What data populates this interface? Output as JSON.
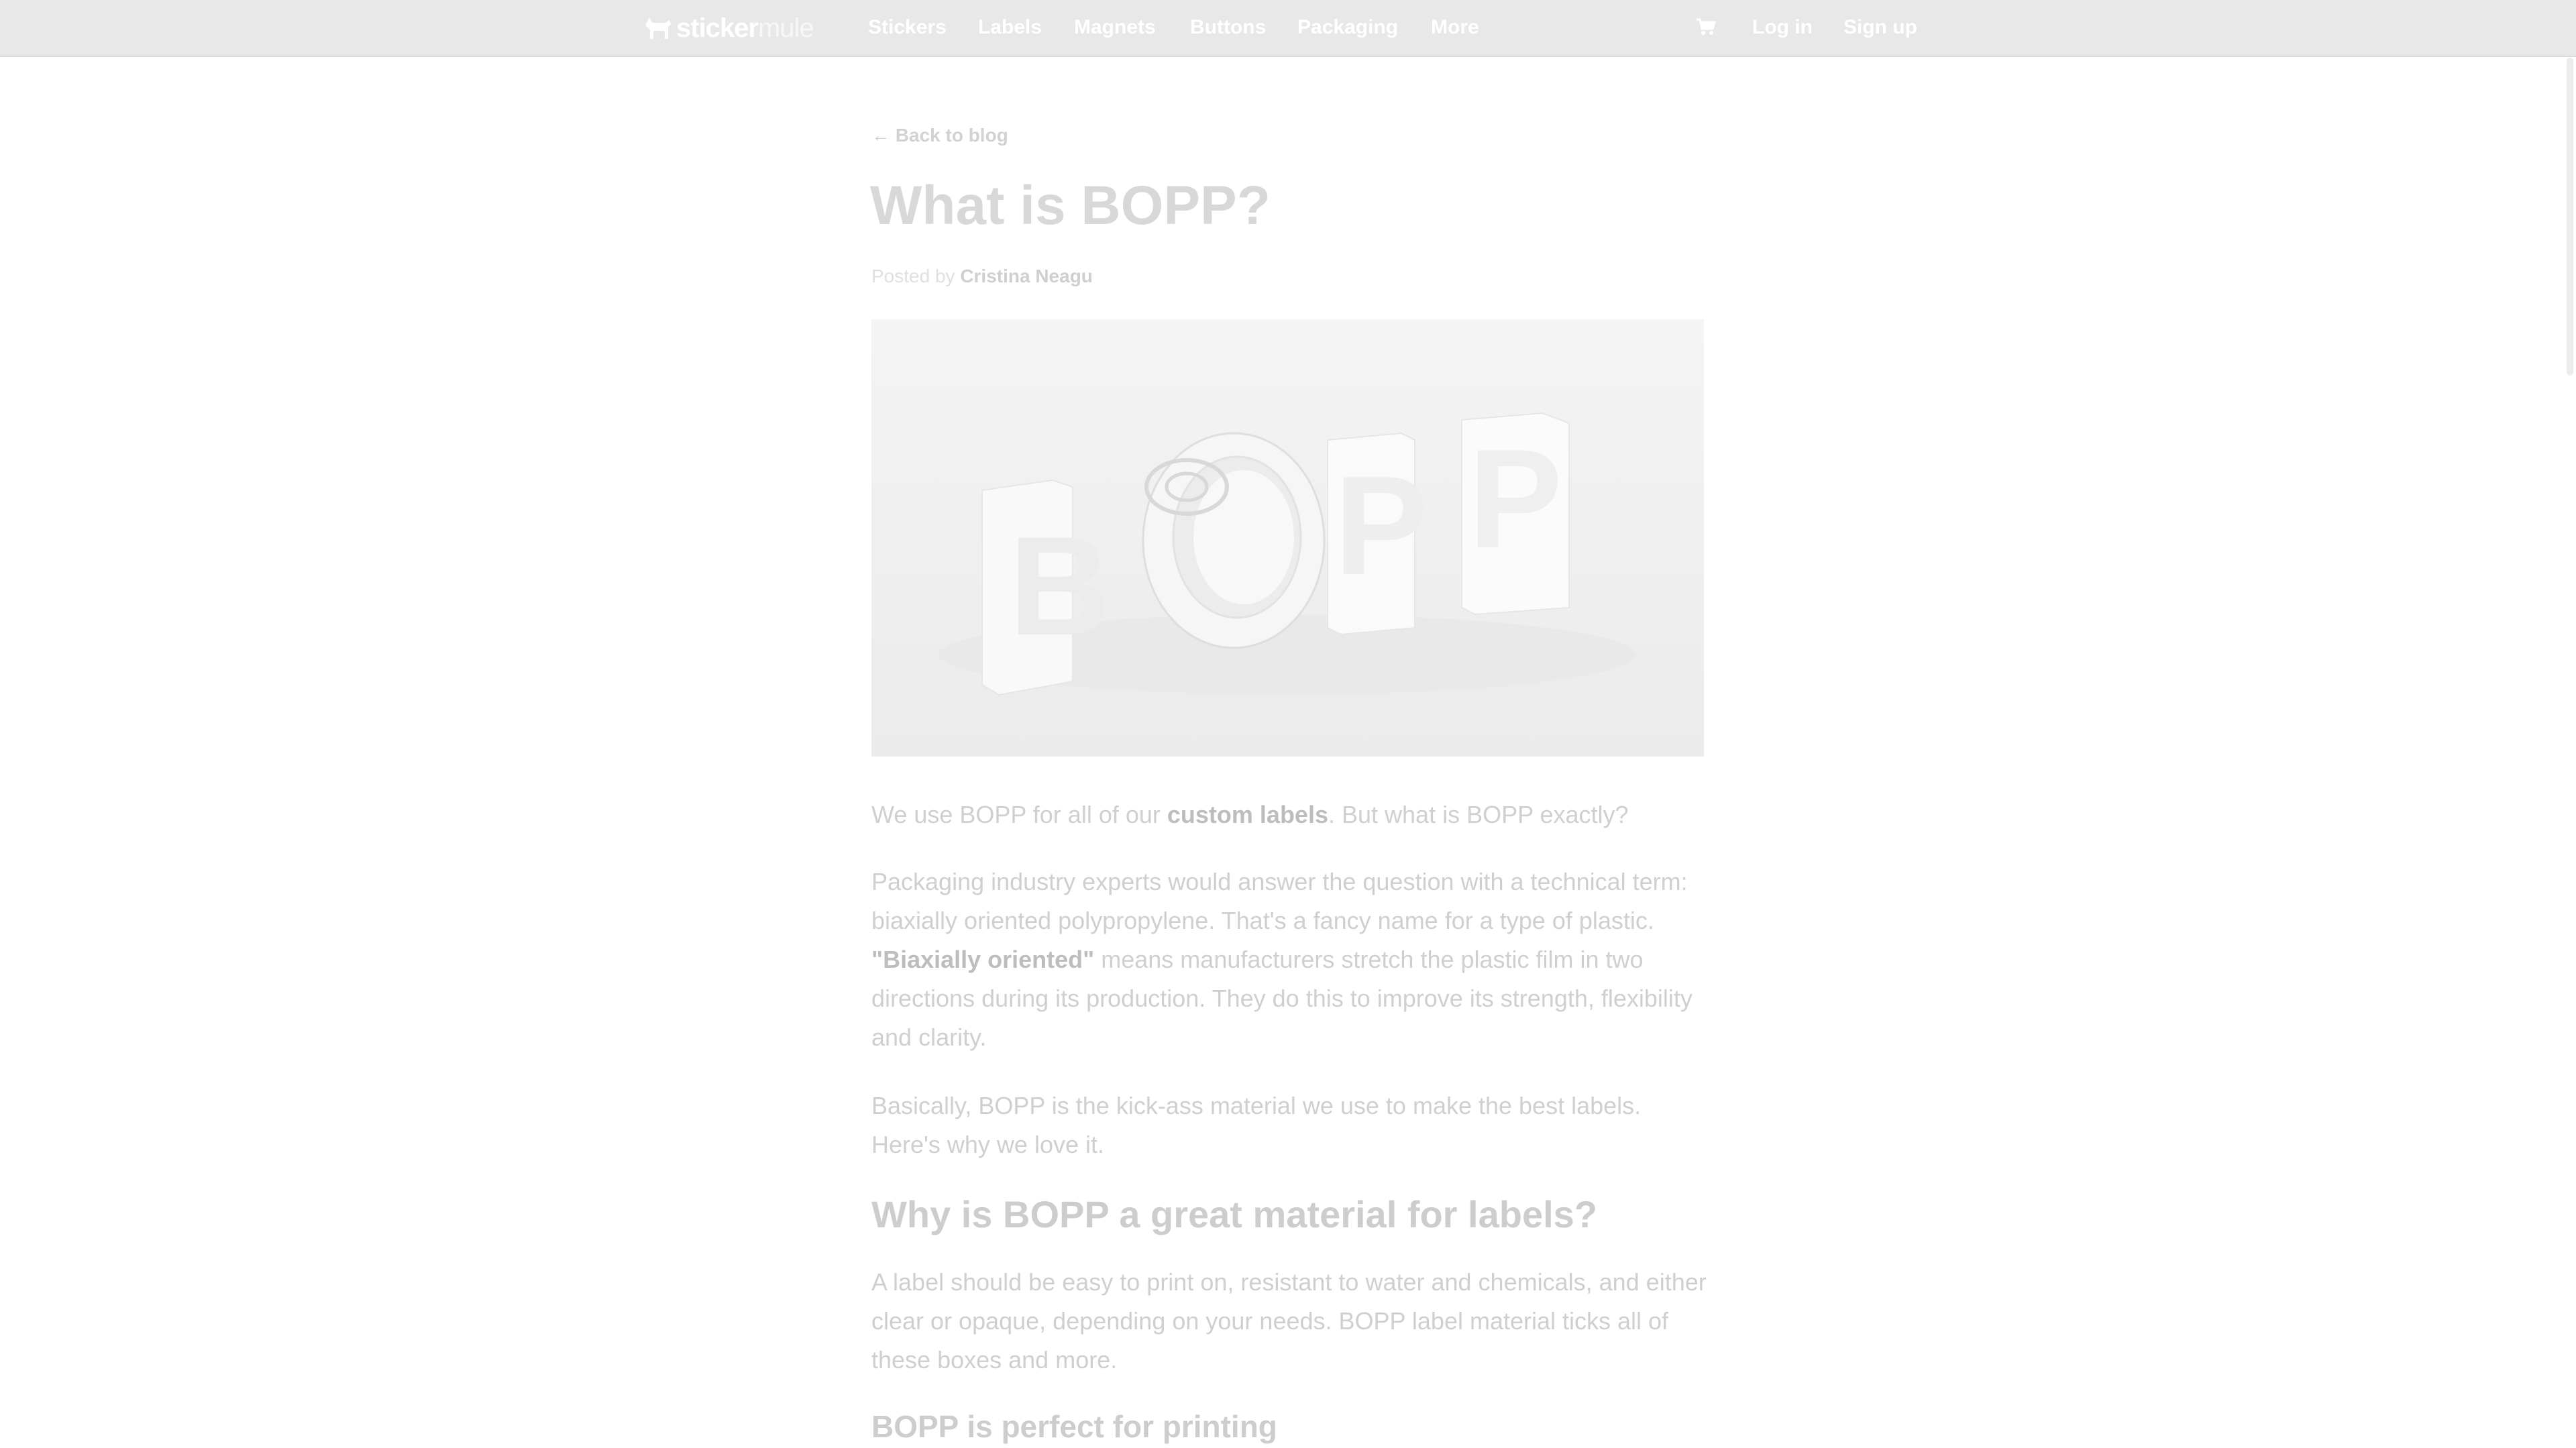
{
  "nav": {
    "logo_bold": "sticker",
    "logo_light": "mule",
    "items": [
      {
        "label": "Stickers"
      },
      {
        "label": "Labels"
      },
      {
        "label": "Magnets"
      },
      {
        "label": "Buttons"
      },
      {
        "label": "Packaging"
      },
      {
        "label": "More"
      }
    ],
    "cart_icon": "cart-icon",
    "login": "Log in",
    "signup": "Sign up"
  },
  "article": {
    "back_link": "← Back to blog",
    "title": "What is BOPP?",
    "byline_prefix": "Posted by",
    "author": "Cristina Neagu",
    "hero_text": "BOPP",
    "p1_before": "We use BOPP for all of our ",
    "p1_link": "custom labels",
    "p1_after": ". But what is BOPP exactly?",
    "p2_before": "Packaging industry experts would answer the question with a technical term: biaxially oriented polypropylene. That's a fancy name for a type of plastic. ",
    "p2_link": "\"Biaxially oriented\"",
    "p2_after": " means manufacturers stretch the plastic film in two directions during its production. They do this to improve its strength, flexibility and clarity.",
    "p3": "Basically, BOPP is the kick-ass material we use to make the best labels. Here's why we love it.",
    "h2": "Why is BOPP a great material for labels?",
    "p4": "A label should be easy to print on, resistant to water and chemicals, and either clear or opaque, depending on your needs. BOPP label material ticks all of these boxes and more.",
    "h3": "BOPP is perfect for printing"
  }
}
